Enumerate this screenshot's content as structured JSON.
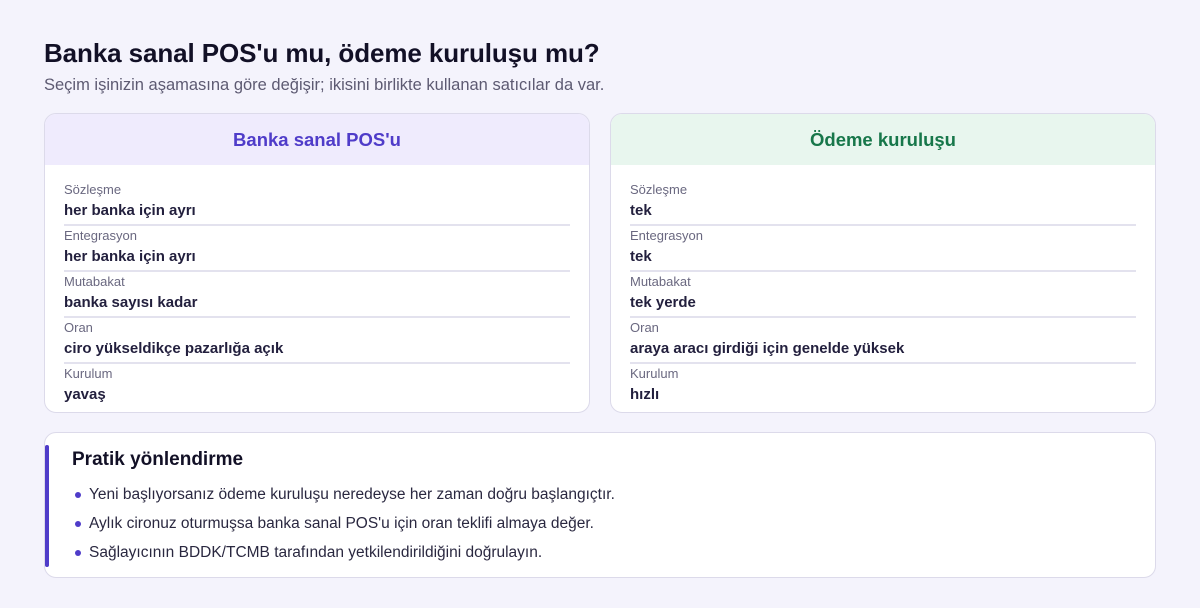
{
  "header": {
    "title": "Banka sanal POS'u mu, ödeme kuruluşu mu?",
    "subtitle": "Seçim işinizin aşamasına göre değişir; ikisini birlikte kullanan satıcılar da var."
  },
  "comparison": {
    "bank": {
      "title": "Banka sanal POS'u",
      "rows": [
        {
          "label": "Sözleşme",
          "value": "her banka için ayrı"
        },
        {
          "label": "Entegrasyon",
          "value": "her banka için ayrı"
        },
        {
          "label": "Mutabakat",
          "value": "banka sayısı kadar"
        },
        {
          "label": "Oran",
          "value": "ciro yükseldikçe pazarlığa açık"
        },
        {
          "label": "Kurulum",
          "value": "yavaş"
        }
      ]
    },
    "psp": {
      "title": "Ödeme kuruluşu",
      "rows": [
        {
          "label": "Sözleşme",
          "value": "tek"
        },
        {
          "label": "Entegrasyon",
          "value": "tek"
        },
        {
          "label": "Mutabakat",
          "value": "tek yerde"
        },
        {
          "label": "Oran",
          "value": "araya aracı girdiği için genelde yüksek"
        },
        {
          "label": "Kurulum",
          "value": "hızlı"
        }
      ]
    }
  },
  "tips": {
    "title": "Pratik yönlendirme",
    "items": [
      "Yeni başlıyorsanız ödeme kuruluşu neredeyse her zaman doğru başlangıçtır.",
      "Aylık cironuz oturmuşsa banka sanal POS'u için oran teklifi almaya değer.",
      "Sağlayıcının BDDK/TCMB tarafından yetkilendirildiğini doğrulayın."
    ]
  },
  "colors": {
    "accent": "#4f3cc9",
    "bank_header_bg": "#efebfd",
    "psp_header_bg": "#e8f6ee",
    "psp_accent": "#17774a",
    "page_bg": "#f4f3fc"
  }
}
